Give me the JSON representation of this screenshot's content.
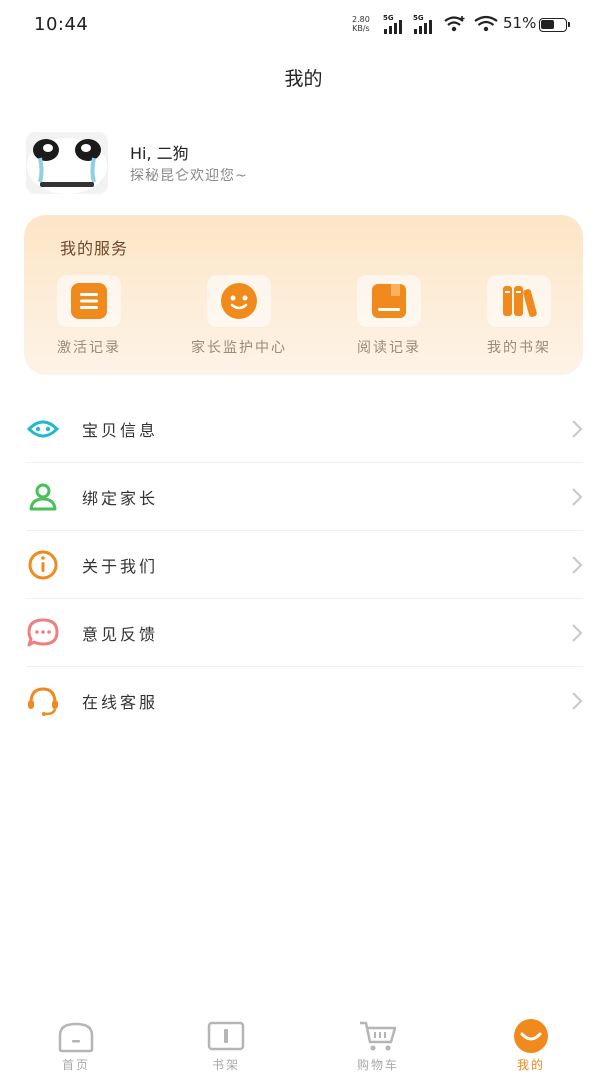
{
  "status_bar": {
    "time": "10:44",
    "net_speed_value": "2.80",
    "net_speed_unit": "KB/s",
    "signal_1": "5G",
    "signal_2": "5G",
    "battery_percent": "51%"
  },
  "page": {
    "title": "我的"
  },
  "profile": {
    "greeting": "Hi, 二狗",
    "subtitle": "探秘昆仑欢迎您~"
  },
  "services": {
    "title": "我的服务",
    "items": [
      {
        "label": "激活记录",
        "icon": "list-icon"
      },
      {
        "label": "家长监护中心",
        "icon": "smile-face-icon"
      },
      {
        "label": "阅读记录",
        "icon": "book-icon"
      },
      {
        "label": "我的书架",
        "icon": "bookshelf-icon"
      }
    ]
  },
  "menu": {
    "items": [
      {
        "label": "宝贝信息",
        "icon": "baby-face-icon"
      },
      {
        "label": "绑定家长",
        "icon": "user-icon"
      },
      {
        "label": "关于我们",
        "icon": "info-icon"
      },
      {
        "label": "意见反馈",
        "icon": "chat-bubble-icon"
      },
      {
        "label": "在线客服",
        "icon": "headset-icon"
      }
    ]
  },
  "tabbar": {
    "items": [
      {
        "label": "首页",
        "icon": "home-icon"
      },
      {
        "label": "书架",
        "icon": "book-open-icon"
      },
      {
        "label": "购物车",
        "icon": "cart-icon"
      },
      {
        "label": "我的",
        "icon": "profile-smile-icon"
      }
    ],
    "active_index": 3
  },
  "colors": {
    "accent": "#f08a1c",
    "card_gradient_top": "#fde5c6",
    "card_gradient_bottom": "#fdf3e6",
    "icon_cyan": "#22b8cf",
    "icon_green": "#4cbf5a",
    "icon_orange": "#f08a1c",
    "icon_pink": "#f07f7f"
  }
}
